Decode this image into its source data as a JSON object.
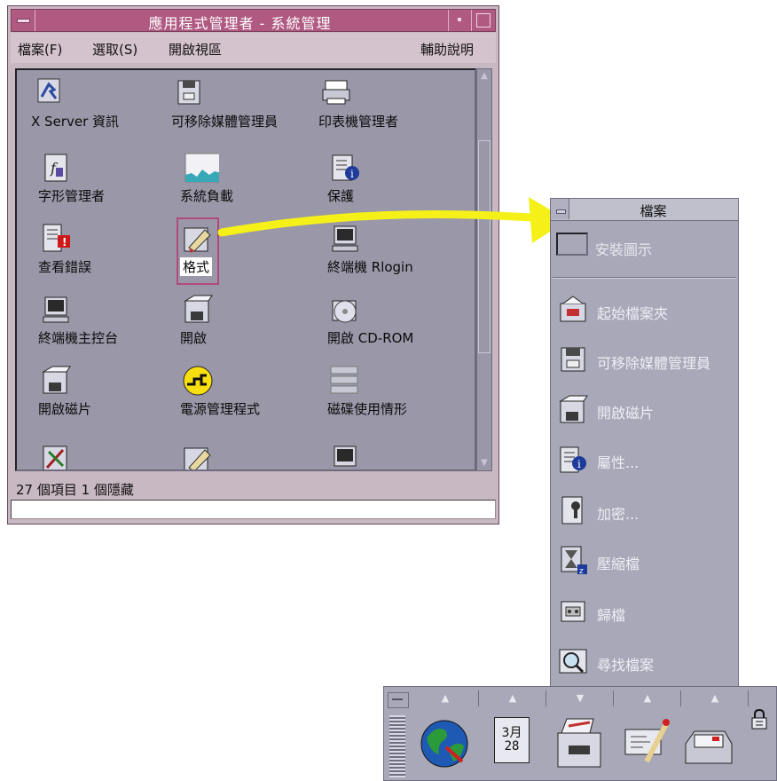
{
  "app_manager": {
    "title": "應用程式管理者 - 系統管理",
    "menu": {
      "file": "檔案(F)",
      "select": "選取(S)",
      "open_view": "開啟視區",
      "help": "輔助說明"
    },
    "items": [
      {
        "label": "X Server 資訊",
        "icon": "x-server-icon"
      },
      {
        "label": "可移除媒體管理員",
        "icon": "removable-media-icon"
      },
      {
        "label": "印表機管理者",
        "icon": "printer-icon"
      },
      {
        "label": "字形管理者",
        "icon": "font-manager-icon"
      },
      {
        "label": "系統負載",
        "icon": "system-load-icon"
      },
      {
        "label": "保護",
        "icon": "protect-info-icon"
      },
      {
        "label": "查看錯誤",
        "icon": "view-errors-icon"
      },
      {
        "label": "格式",
        "icon": "format-icon"
      },
      {
        "label": "終端機 Rlogin",
        "icon": "terminal-icon"
      },
      {
        "label": "終端機主控台",
        "icon": "console-terminal-icon"
      },
      {
        "label": "開啟",
        "icon": "open-floppy-icon"
      },
      {
        "label": "開啟 CD-ROM",
        "icon": "cdrom-icon"
      },
      {
        "label": "開啟磁片",
        "icon": "open-diskette-icon"
      },
      {
        "label": "電源管理程式",
        "icon": "power-manager-icon"
      },
      {
        "label": "磁碟使用情形",
        "icon": "disk-usage-icon"
      }
    ],
    "status": "27 個項目 1 個隱藏"
  },
  "subpanel": {
    "title": "檔案",
    "install_label": "安裝圖示",
    "items": [
      {
        "label": "起始檔案夾",
        "icon": "home-folder-icon"
      },
      {
        "label": "可移除媒體管理員",
        "icon": "removable-media-icon"
      },
      {
        "label": "開啟磁片",
        "icon": "open-diskette-icon"
      },
      {
        "label": "屬性...",
        "icon": "properties-icon"
      },
      {
        "label": "加密...",
        "icon": "encrypt-icon"
      },
      {
        "label": "壓縮檔",
        "icon": "compress-icon"
      },
      {
        "label": "歸檔",
        "icon": "archive-icon"
      },
      {
        "label": "尋找檔案",
        "icon": "find-file-icon"
      }
    ]
  },
  "front_panel": {
    "calendar_month": "3月",
    "calendar_day": "28",
    "icons": [
      "globe-icon",
      "calendar-icon",
      "file-manager-icon",
      "mail-compose-icon",
      "inbox-icon",
      "lock-icon"
    ]
  },
  "colors": {
    "titlebar": "#b05a82",
    "workspace_bg": "#9a98a8",
    "panel_bg": "#a8a8b8",
    "arrow": "#f4f018"
  }
}
